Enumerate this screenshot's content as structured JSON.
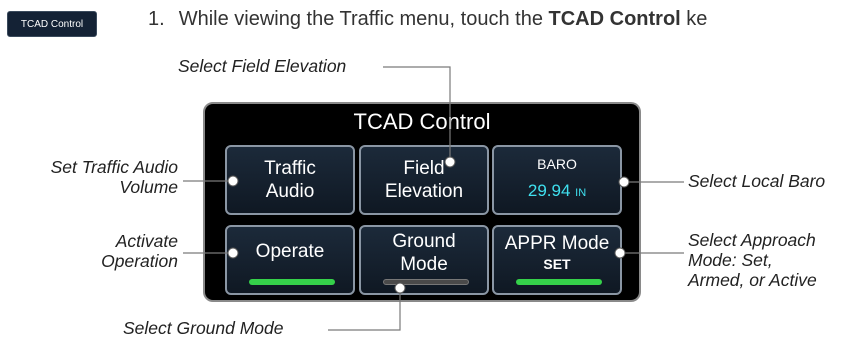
{
  "tag_button": "TCAD Control",
  "instruction": {
    "number": "1.",
    "text_before": "While viewing the Traffic menu, touch the ",
    "bold": "TCAD Control",
    "text_after": " ke"
  },
  "panel": {
    "title": "TCAD Control",
    "keys": {
      "traffic_audio": [
        "Traffic",
        "Audio"
      ],
      "field_elevation": [
        "Field",
        "Elevation"
      ],
      "baro": {
        "label": "BARO",
        "value": "29.94",
        "unit": "IN"
      },
      "operate": "Operate",
      "ground_mode": [
        "Ground",
        "Mode"
      ],
      "appr_mode": {
        "label": "APPR Mode",
        "value": "SET"
      }
    }
  },
  "callouts": {
    "field_elevation": "Select Field Elevation",
    "traffic_audio": [
      "Set Traffic Audio",
      "Volume"
    ],
    "baro": "Select Local Baro",
    "operate": [
      "Activate",
      "Operation"
    ],
    "approach": [
      "Select Approach",
      "Mode: Set,",
      "Armed, or Active"
    ],
    "ground": "Select Ground Mode"
  },
  "colors": {
    "panel_bg": "#000000",
    "active_bar": "#35d14a",
    "baro_value": "#3fe0ef"
  }
}
